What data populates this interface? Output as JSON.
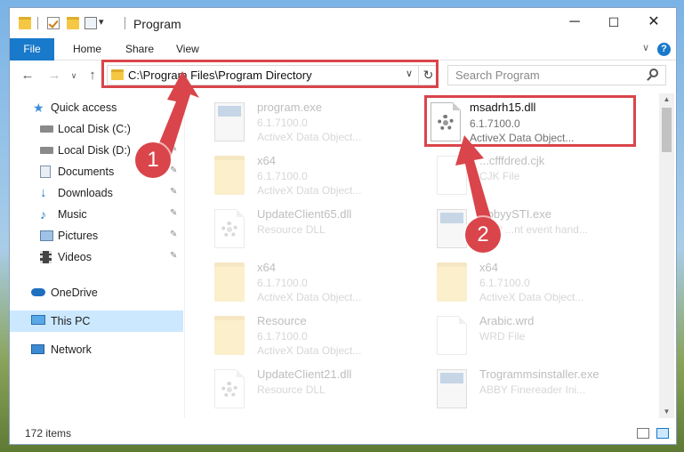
{
  "window": {
    "title": "Program",
    "controls": {
      "minimize": "─",
      "maximize": "☐",
      "close": "✕"
    }
  },
  "ribbon": {
    "tabs": [
      "File",
      "Home",
      "Share",
      "View"
    ],
    "help": "?",
    "collapse": "∨"
  },
  "nav": {
    "back": "←",
    "forward": "→",
    "recent": "∨",
    "up": "↑",
    "address": "C:\\Program Files\\Program Directory",
    "address_dropdown": "∨",
    "refresh": "↻",
    "search_placeholder": "Search Program"
  },
  "sidebar": {
    "items": [
      {
        "label": "Quick access",
        "icon": "star-icon"
      },
      {
        "label": "Local Disk (C:)",
        "icon": "drive-icon",
        "pinned": true
      },
      {
        "label": "Local Disk (D:)",
        "icon": "drive-icon",
        "pinned": true
      },
      {
        "label": "Documents",
        "icon": "documents-icon",
        "pinned": true
      },
      {
        "label": "Downloads",
        "icon": "downloads-icon",
        "pinned": true
      },
      {
        "label": "Music",
        "icon": "music-icon",
        "pinned": true
      },
      {
        "label": "Pictures",
        "icon": "pictures-icon",
        "pinned": true
      },
      {
        "label": "Videos",
        "icon": "videos-icon",
        "pinned": true
      },
      {
        "label": "OneDrive",
        "icon": "cloud-icon"
      },
      {
        "label": "This PC",
        "icon": "computer-icon",
        "selected": true
      },
      {
        "label": "Network",
        "icon": "network-icon"
      }
    ],
    "pin_glyph": "📌"
  },
  "files": {
    "highlighted": {
      "name": "msadrh15.dll",
      "line1": "6.1.7100.0",
      "line2": "ActiveX Data Object..."
    },
    "left_column": [
      {
        "name": "program.exe",
        "line1": "6.1.7100.0",
        "line2": "ActiveX Data Object..."
      },
      {
        "name": "x64",
        "line1": "6.1.7100.0",
        "line2": "ActiveX Data Object..."
      },
      {
        "name": "UpdateClient65.dll",
        "line1": "Resource DLL",
        "line2": ""
      },
      {
        "name": "x64",
        "line1": "6.1.7100.0",
        "line2": "ActiveX Data Object..."
      },
      {
        "name": "Resource",
        "line1": "6.1.7100.0",
        "line2": "ActiveX Data Object..."
      },
      {
        "name": "UpdateClient21.dll",
        "line1": "Resource DLL",
        "line2": ""
      }
    ],
    "right_column": [
      {
        "name": "...cfffdred.cjk",
        "line1": "CJK File",
        "line2": ""
      },
      {
        "name": "AbbyySTI.exe",
        "line1": "...AP ...nt event hand...",
        "line2": ""
      },
      {
        "name": "x64",
        "line1": "6.1.7100.0",
        "line2": "ActiveX Data Object..."
      },
      {
        "name": "Arabic.wrd",
        "line1": "WRD File",
        "line2": ""
      },
      {
        "name": "Trogrammsinstaller.exe",
        "line1": "ABBY Finereader Ini...",
        "line2": ""
      }
    ]
  },
  "annotations": {
    "step1": "1",
    "step2": "2",
    "accent": "#d9454a"
  },
  "status": {
    "count": "172 items"
  }
}
